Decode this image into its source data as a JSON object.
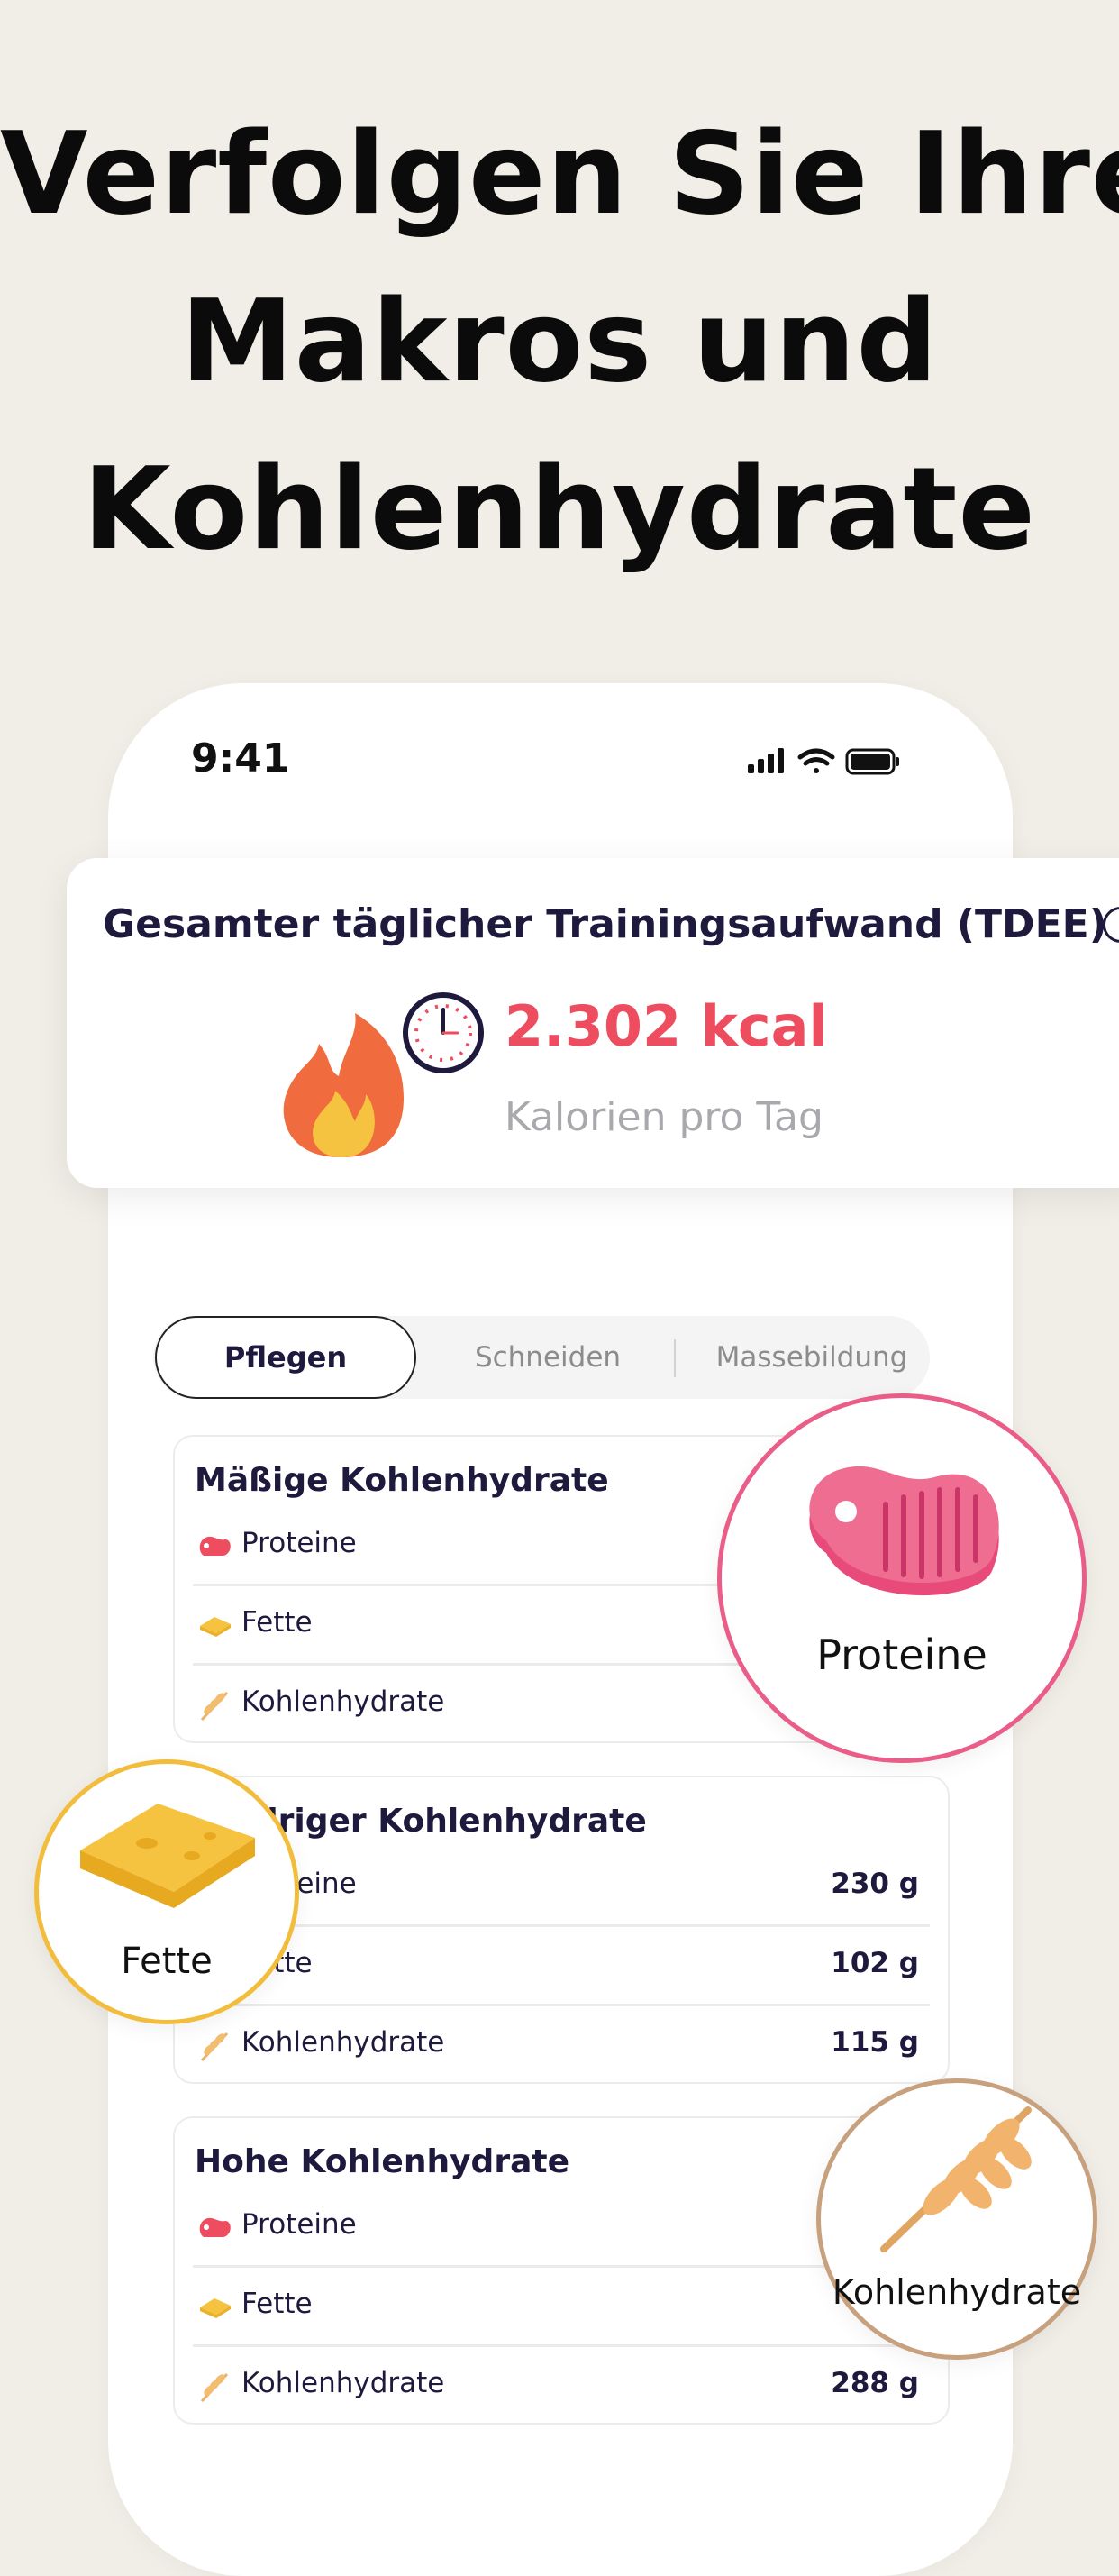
{
  "headline": [
    "Verfolgen Sie Ihre",
    "Makros und",
    "Kohlenhydrate"
  ],
  "status_bar": {
    "time": "9:41"
  },
  "tdee": {
    "title": "Gesamter täglicher Trainingsaufwand (TDEE)",
    "value": "2.302 kcal",
    "subtitle": "Kalorien pro Tag"
  },
  "tabs": [
    "Pflegen",
    "Schneiden",
    "Massebildung"
  ],
  "plans": [
    {
      "title": "Mäßige Kohlenhydrate",
      "rows": [
        {
          "label": "Proteine",
          "value": ""
        },
        {
          "label": "Fette",
          "value": ""
        },
        {
          "label": "Kohlenhydrate",
          "value": ""
        }
      ]
    },
    {
      "title": "Niedriger Kohlenhydrate",
      "rows": [
        {
          "label": "Proteine",
          "value": "230 g"
        },
        {
          "label": "Fette",
          "value": "102 g"
        },
        {
          "label": "Kohlenhydrate",
          "value": "115 g"
        }
      ]
    },
    {
      "title": "Hohe Kohlenhydrate",
      "rows": [
        {
          "label": "Proteine",
          "value": ""
        },
        {
          "label": "Fette",
          "value": ""
        },
        {
          "label": "Kohlenhydrate",
          "value": "288 g"
        }
      ]
    }
  ],
  "bubbles": {
    "protein": "Proteine",
    "fat": "Fette",
    "carb": "Kohlenhydrate"
  },
  "colors": {
    "accent_red": "#ee4c5f",
    "protein_pink": "#ea5d88",
    "fat_yellow": "#f2bd3c",
    "carb_brown": "#c7a07d",
    "background": "#f1ede7"
  }
}
